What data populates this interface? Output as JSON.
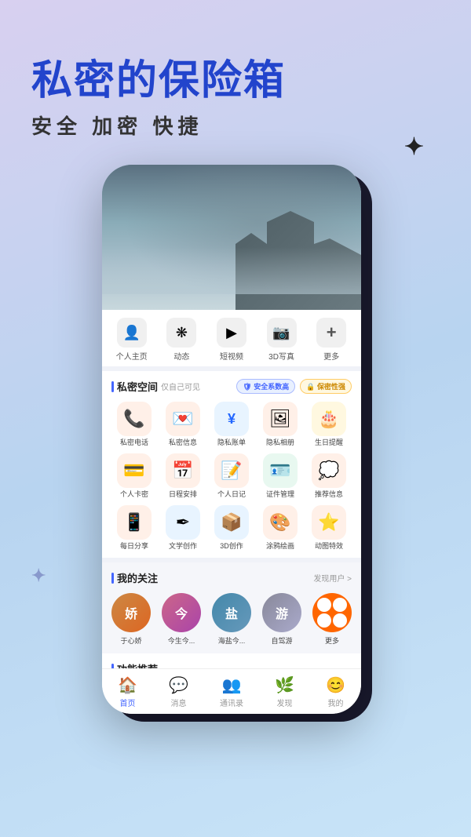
{
  "page": {
    "background": "gradient purple-blue",
    "title_main": "私密的保险箱",
    "title_sub": "安全   加密   快捷"
  },
  "phone": {
    "nav_items": [
      {
        "icon": "👤",
        "label": "个人主页"
      },
      {
        "icon": "❋",
        "label": "动态"
      },
      {
        "icon": "▶",
        "label": "短视频"
      },
      {
        "icon": "📷",
        "label": "3D写真"
      },
      {
        "icon": "+",
        "label": "更多"
      }
    ],
    "private_section": {
      "title": "私密空间",
      "subtitle": "仅自己可见",
      "badge_security": "安全系数高",
      "badge_privacy": "保密性强",
      "grid_items": [
        {
          "icon": "📞",
          "label": "私密电话",
          "color": "#fff0e8",
          "icon_color": "#ff6600"
        },
        {
          "icon": "💬",
          "label": "私密信息",
          "color": "#fff0e8",
          "icon_color": "#ff8800"
        },
        {
          "icon": "¥",
          "label": "隐私账单",
          "color": "#e8f4ff",
          "icon_color": "#2266ff"
        },
        {
          "icon": "🖼",
          "label": "隐私相册",
          "color": "#fff0e8",
          "icon_color": "#ff8800"
        },
        {
          "icon": "🎂",
          "label": "生日提醒",
          "color": "#fff8e0",
          "icon_color": "#ffaa00"
        },
        {
          "icon": "💳",
          "label": "个人卡密",
          "color": "#fff0e8",
          "icon_color": "#ff6600"
        },
        {
          "icon": "📅",
          "label": "日程安排",
          "color": "#fff0e8",
          "icon_color": "#ff8800"
        },
        {
          "icon": "✉",
          "label": "个人日记",
          "color": "#fff0e8",
          "icon_color": "#ff7700"
        },
        {
          "icon": "🪪",
          "label": "证件管理",
          "color": "#e8f8f0",
          "icon_color": "#00aa66"
        },
        {
          "icon": "💭",
          "label": "推荐信息",
          "color": "#fff0e8",
          "icon_color": "#ff9900"
        },
        {
          "icon": "📱",
          "label": "每日分享",
          "color": "#fff0e8",
          "icon_color": "#ff6600"
        },
        {
          "icon": "✒",
          "label": "文学创作",
          "color": "#e8f4ff",
          "icon_color": "#4466ff"
        },
        {
          "icon": "📦",
          "label": "3D创作",
          "color": "#e8f4ff",
          "icon_color": "#4488ff"
        },
        {
          "icon": "🎨",
          "label": "涂鸦绘画",
          "color": "#fff0e8",
          "icon_color": "#ff8800"
        },
        {
          "icon": "⭐",
          "label": "动图特效",
          "color": "#fff0e8",
          "icon_color": "#ffaa00"
        }
      ]
    },
    "follows_section": {
      "title": "我的关注",
      "link": "发现用户 >",
      "follows": [
        {
          "name": "于心娇",
          "bg": "av1"
        },
        {
          "name": "今生今...",
          "bg": "av2"
        },
        {
          "name": "海盐今...",
          "bg": "av3"
        },
        {
          "name": "自驾游",
          "bg": "av4"
        },
        {
          "name": "更多",
          "type": "more"
        }
      ]
    },
    "recommend_section": {
      "title": "功能推荐"
    },
    "bottom_nav": [
      {
        "icon": "🏠",
        "label": "首页",
        "active": true
      },
      {
        "icon": "💬",
        "label": "消息",
        "active": false
      },
      {
        "icon": "👥",
        "label": "通讯录",
        "active": false
      },
      {
        "icon": "🌿",
        "label": "发现",
        "active": false
      },
      {
        "icon": "😊",
        "label": "我的",
        "active": false
      }
    ]
  },
  "sparkles": {
    "top_right": "✦",
    "bottom_left": "✦"
  }
}
